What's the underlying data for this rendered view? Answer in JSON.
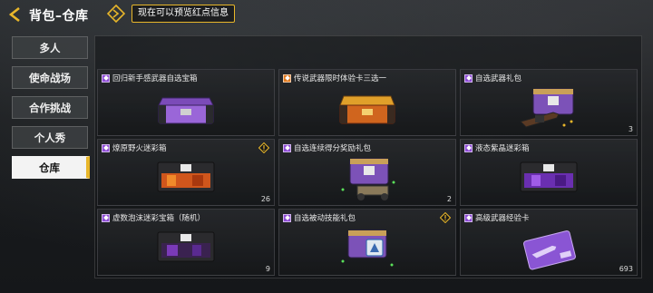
{
  "header": {
    "title": "背包–仓库",
    "notice": "现在可以预览红点信息"
  },
  "sidebar": {
    "items": [
      {
        "label": "多人",
        "active": false
      },
      {
        "label": "使命战场",
        "active": false
      },
      {
        "label": "合作挑战",
        "active": false
      },
      {
        "label": "个人秀",
        "active": false
      },
      {
        "label": "仓库",
        "active": true
      }
    ]
  },
  "colors": {
    "accent_yellow": "#e8b62a",
    "rarity_purple": "#8e4bd6",
    "rarity_orange": "#e07a1f"
  },
  "items": [
    {
      "label": "回归新手感武器自选宝箱",
      "rarity": "purple",
      "count": "",
      "warning": false,
      "icon": "purple-crate-icon"
    },
    {
      "label": "传说武器限时体验卡三选一",
      "rarity": "orange",
      "count": "",
      "warning": false,
      "icon": "gold-crate-icon"
    },
    {
      "label": "自选武器礼包",
      "rarity": "purple",
      "count": "3",
      "warning": false,
      "icon": "weapon-case-rifle-icon"
    },
    {
      "label": "燎原野火迷彩箱",
      "rarity": "purple",
      "count": "26",
      "warning": true,
      "icon": "fire-camo-crate-icon"
    },
    {
      "label": "自选连续得分奖励礼包",
      "rarity": "purple",
      "count": "2",
      "warning": false,
      "icon": "scorestreak-case-icon"
    },
    {
      "label": "液态紫晶迷彩箱",
      "rarity": "purple",
      "count": "",
      "warning": false,
      "icon": "amethyst-camo-crate-icon"
    },
    {
      "label": "虚数泡沫迷彩宝箱（随机）",
      "rarity": "purple",
      "count": "9",
      "warning": false,
      "icon": "foam-camo-crate-icon"
    },
    {
      "label": "自选被动技能礼包",
      "rarity": "purple",
      "count": "",
      "warning": true,
      "icon": "perk-case-icon"
    },
    {
      "label": "高级武器经验卡",
      "rarity": "purple",
      "count": "693",
      "warning": false,
      "icon": "weapon-xp-card-icon"
    }
  ]
}
